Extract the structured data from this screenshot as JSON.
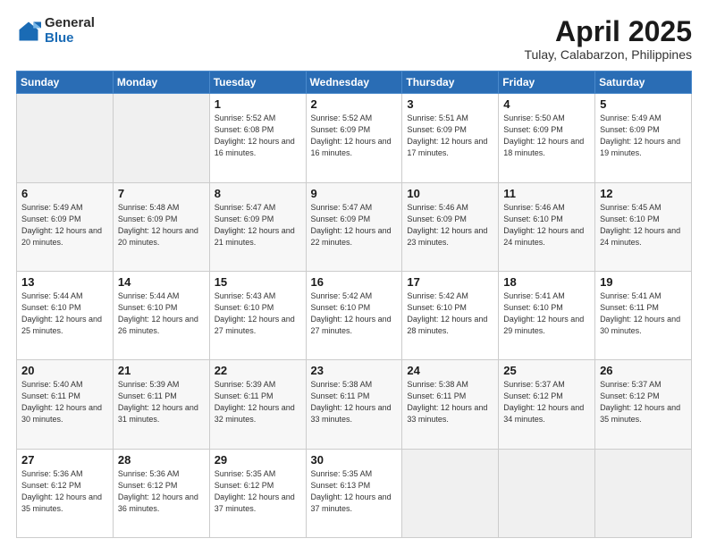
{
  "logo": {
    "general": "General",
    "blue": "Blue"
  },
  "title": "April 2025",
  "subtitle": "Tulay, Calabarzon, Philippines",
  "days_of_week": [
    "Sunday",
    "Monday",
    "Tuesday",
    "Wednesday",
    "Thursday",
    "Friday",
    "Saturday"
  ],
  "weeks": [
    [
      {
        "day": "",
        "info": ""
      },
      {
        "day": "",
        "info": ""
      },
      {
        "day": "1",
        "info": "Sunrise: 5:52 AM\nSunset: 6:08 PM\nDaylight: 12 hours and 16 minutes."
      },
      {
        "day": "2",
        "info": "Sunrise: 5:52 AM\nSunset: 6:09 PM\nDaylight: 12 hours and 16 minutes."
      },
      {
        "day": "3",
        "info": "Sunrise: 5:51 AM\nSunset: 6:09 PM\nDaylight: 12 hours and 17 minutes."
      },
      {
        "day": "4",
        "info": "Sunrise: 5:50 AM\nSunset: 6:09 PM\nDaylight: 12 hours and 18 minutes."
      },
      {
        "day": "5",
        "info": "Sunrise: 5:49 AM\nSunset: 6:09 PM\nDaylight: 12 hours and 19 minutes."
      }
    ],
    [
      {
        "day": "6",
        "info": "Sunrise: 5:49 AM\nSunset: 6:09 PM\nDaylight: 12 hours and 20 minutes."
      },
      {
        "day": "7",
        "info": "Sunrise: 5:48 AM\nSunset: 6:09 PM\nDaylight: 12 hours and 20 minutes."
      },
      {
        "day": "8",
        "info": "Sunrise: 5:47 AM\nSunset: 6:09 PM\nDaylight: 12 hours and 21 minutes."
      },
      {
        "day": "9",
        "info": "Sunrise: 5:47 AM\nSunset: 6:09 PM\nDaylight: 12 hours and 22 minutes."
      },
      {
        "day": "10",
        "info": "Sunrise: 5:46 AM\nSunset: 6:09 PM\nDaylight: 12 hours and 23 minutes."
      },
      {
        "day": "11",
        "info": "Sunrise: 5:46 AM\nSunset: 6:10 PM\nDaylight: 12 hours and 24 minutes."
      },
      {
        "day": "12",
        "info": "Sunrise: 5:45 AM\nSunset: 6:10 PM\nDaylight: 12 hours and 24 minutes."
      }
    ],
    [
      {
        "day": "13",
        "info": "Sunrise: 5:44 AM\nSunset: 6:10 PM\nDaylight: 12 hours and 25 minutes."
      },
      {
        "day": "14",
        "info": "Sunrise: 5:44 AM\nSunset: 6:10 PM\nDaylight: 12 hours and 26 minutes."
      },
      {
        "day": "15",
        "info": "Sunrise: 5:43 AM\nSunset: 6:10 PM\nDaylight: 12 hours and 27 minutes."
      },
      {
        "day": "16",
        "info": "Sunrise: 5:42 AM\nSunset: 6:10 PM\nDaylight: 12 hours and 27 minutes."
      },
      {
        "day": "17",
        "info": "Sunrise: 5:42 AM\nSunset: 6:10 PM\nDaylight: 12 hours and 28 minutes."
      },
      {
        "day": "18",
        "info": "Sunrise: 5:41 AM\nSunset: 6:10 PM\nDaylight: 12 hours and 29 minutes."
      },
      {
        "day": "19",
        "info": "Sunrise: 5:41 AM\nSunset: 6:11 PM\nDaylight: 12 hours and 30 minutes."
      }
    ],
    [
      {
        "day": "20",
        "info": "Sunrise: 5:40 AM\nSunset: 6:11 PM\nDaylight: 12 hours and 30 minutes."
      },
      {
        "day": "21",
        "info": "Sunrise: 5:39 AM\nSunset: 6:11 PM\nDaylight: 12 hours and 31 minutes."
      },
      {
        "day": "22",
        "info": "Sunrise: 5:39 AM\nSunset: 6:11 PM\nDaylight: 12 hours and 32 minutes."
      },
      {
        "day": "23",
        "info": "Sunrise: 5:38 AM\nSunset: 6:11 PM\nDaylight: 12 hours and 33 minutes."
      },
      {
        "day": "24",
        "info": "Sunrise: 5:38 AM\nSunset: 6:11 PM\nDaylight: 12 hours and 33 minutes."
      },
      {
        "day": "25",
        "info": "Sunrise: 5:37 AM\nSunset: 6:12 PM\nDaylight: 12 hours and 34 minutes."
      },
      {
        "day": "26",
        "info": "Sunrise: 5:37 AM\nSunset: 6:12 PM\nDaylight: 12 hours and 35 minutes."
      }
    ],
    [
      {
        "day": "27",
        "info": "Sunrise: 5:36 AM\nSunset: 6:12 PM\nDaylight: 12 hours and 35 minutes."
      },
      {
        "day": "28",
        "info": "Sunrise: 5:36 AM\nSunset: 6:12 PM\nDaylight: 12 hours and 36 minutes."
      },
      {
        "day": "29",
        "info": "Sunrise: 5:35 AM\nSunset: 6:12 PM\nDaylight: 12 hours and 37 minutes."
      },
      {
        "day": "30",
        "info": "Sunrise: 5:35 AM\nSunset: 6:13 PM\nDaylight: 12 hours and 37 minutes."
      },
      {
        "day": "",
        "info": ""
      },
      {
        "day": "",
        "info": ""
      },
      {
        "day": "",
        "info": ""
      }
    ]
  ]
}
